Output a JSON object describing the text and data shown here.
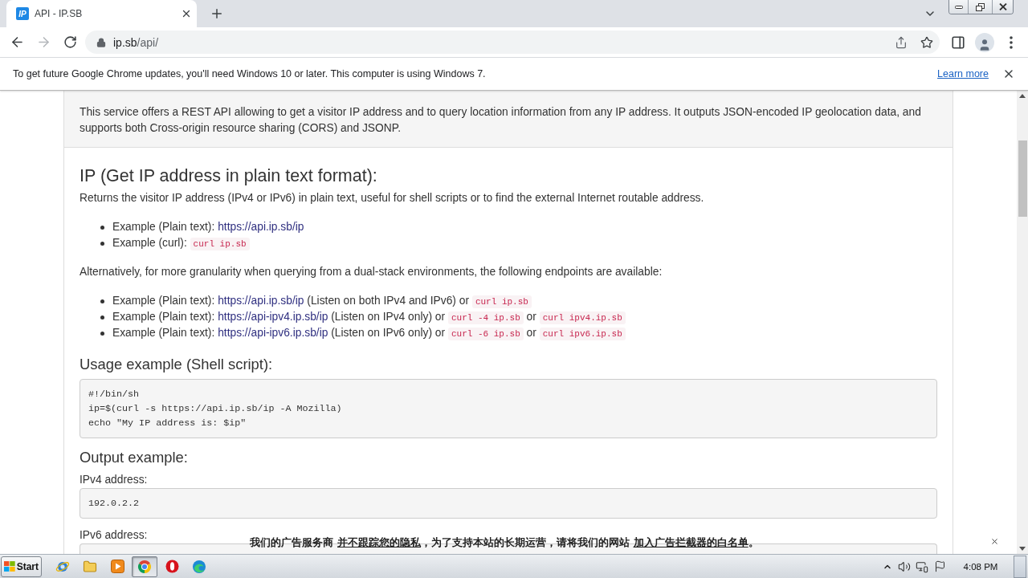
{
  "tab": {
    "favicon_text": "IP",
    "title": "API - IP.SB",
    "selected": true
  },
  "toolbar": {
    "back_disabled": false,
    "forward_disabled": true,
    "address": {
      "host": "ip.sb",
      "path": "/api/"
    }
  },
  "infobar": {
    "message": "To get future Google Chrome updates, you'll need Windows 10 or later. This computer is using Windows 7.",
    "link": "Learn more"
  },
  "page": {
    "intro": "This service offers a REST API allowing to get a visitor IP address and to query location information from any IP address. It outputs JSON-encoded IP geolocation data, and supports both Cross-origin resource sharing (CORS) and JSONP.",
    "sections": [
      {
        "heading": "IP (Get IP address in plain text format):",
        "blocks": [
          {
            "kind": "paragraph",
            "text": "Returns the visitor IP address (IPv4 or IPv6) in plain text, useful for shell scripts or to find the external Internet routable address."
          },
          {
            "kind": "list",
            "items": [
              {
                "parts": [
                  {
                    "kind": "text",
                    "text": "Example (Plain text): "
                  },
                  {
                    "kind": "link",
                    "text": "https://api.ip.sb/ip"
                  }
                ]
              },
              {
                "parts": [
                  {
                    "kind": "text",
                    "text": "Example (curl): "
                  },
                  {
                    "kind": "code",
                    "text": "curl ip.sb"
                  }
                ]
              }
            ]
          },
          {
            "kind": "paragraph",
            "text": "Alternatively, for more granularity when querying from a dual-stack environments, the following endpoints are available:"
          },
          {
            "kind": "list",
            "items": [
              {
                "parts": [
                  {
                    "kind": "text",
                    "text": "Example (Plain text): "
                  },
                  {
                    "kind": "link",
                    "text": "https://api.ip.sb/ip"
                  },
                  {
                    "kind": "text",
                    "text": " (Listen on both IPv4 and IPv6) or "
                  },
                  {
                    "kind": "code",
                    "text": "curl ip.sb"
                  }
                ]
              },
              {
                "parts": [
                  {
                    "kind": "text",
                    "text": "Example (Plain text): "
                  },
                  {
                    "kind": "link",
                    "text": "https://api-ipv4.ip.sb/ip"
                  },
                  {
                    "kind": "text",
                    "text": " (Listen on IPv4 only) or "
                  },
                  {
                    "kind": "code",
                    "text": "curl -4 ip.sb"
                  },
                  {
                    "kind": "text",
                    "text": " or "
                  },
                  {
                    "kind": "code",
                    "text": "curl ipv4.ip.sb"
                  }
                ]
              },
              {
                "parts": [
                  {
                    "kind": "text",
                    "text": "Example (Plain text): "
                  },
                  {
                    "kind": "link",
                    "text": "https://api-ipv6.ip.sb/ip"
                  },
                  {
                    "kind": "text",
                    "text": " (Listen on IPv6 only) or "
                  },
                  {
                    "kind": "code",
                    "text": "curl -6 ip.sb"
                  },
                  {
                    "kind": "text",
                    "text": " or "
                  },
                  {
                    "kind": "code",
                    "text": "curl ipv6.ip.sb"
                  }
                ]
              }
            ]
          }
        ]
      },
      {
        "heading": "Usage example (Shell script):",
        "blocks": [
          {
            "kind": "code",
            "lines": [
              "#!/bin/sh",
              "ip=$(curl -s https://api.ip.sb/ip -A Mozilla)",
              "echo \"My IP address is: $ip\""
            ]
          }
        ]
      },
      {
        "heading": "Output example:",
        "blocks": [
          {
            "kind": "label",
            "text": "IPv4 address:"
          },
          {
            "kind": "code",
            "lines": [
              "192.0.2.2"
            ]
          },
          {
            "kind": "label",
            "text": "IPv6 address:"
          },
          {
            "kind": "code"
          }
        ]
      }
    ]
  },
  "ad_banner": {
    "parts": [
      {
        "kind": "text",
        "text": "我们的广告服务商 "
      },
      {
        "kind": "link",
        "text": "并不跟踪您的隐私"
      },
      {
        "kind": "text",
        "text": "，为了支持本站的长期运营，请将我们的网站 "
      },
      {
        "kind": "link",
        "text": "加入广告拦截器的白名单"
      },
      {
        "kind": "text",
        "text": "。"
      }
    ]
  },
  "taskbar": {
    "start": "Start",
    "apps": [
      {
        "kind": "ie",
        "selected": false
      },
      {
        "kind": "folder",
        "selected": false
      },
      {
        "kind": "media",
        "selected": false
      },
      {
        "kind": "chrome",
        "selected": true
      },
      {
        "kind": "opera",
        "selected": false
      },
      {
        "kind": "edge",
        "selected": false
      }
    ],
    "clock": "4:08 PM"
  }
}
